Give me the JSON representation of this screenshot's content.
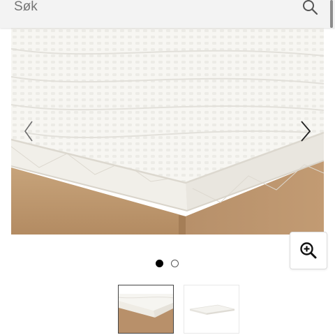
{
  "search": {
    "placeholder": "Søk",
    "icon": "search-icon"
  },
  "gallery": {
    "image_alt": "mattress-topper",
    "prev_icon": "chevron-left-icon",
    "next_icon": "chevron-right-icon",
    "active_index": 1,
    "total": 2
  },
  "zoom": {
    "icon": "zoom-in-icon"
  },
  "thumbnails": [
    {
      "name": "thumbnail-topper-on-bed",
      "selected": true
    },
    {
      "name": "thumbnail-topper-flat",
      "selected": false
    }
  ],
  "colors": {
    "accent": "#000000",
    "base": "#b48e66",
    "topper": "#f6f5f1"
  }
}
